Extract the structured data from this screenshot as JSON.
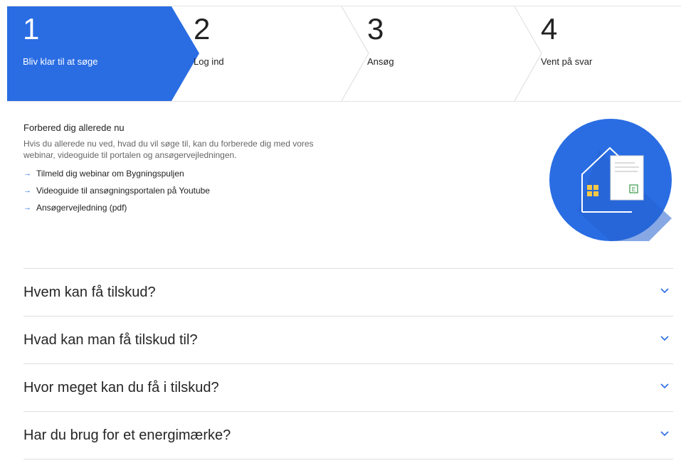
{
  "stepper": {
    "steps": [
      {
        "number": "1",
        "label": "Bliv klar til at søge",
        "active": true
      },
      {
        "number": "2",
        "label": "Log ind",
        "active": false
      },
      {
        "number": "3",
        "label": "Ansøg",
        "active": false
      },
      {
        "number": "4",
        "label": "Vent på svar",
        "active": false
      }
    ],
    "active_color": "#2a6de3"
  },
  "intro": {
    "heading": "Forbered dig allerede nu",
    "text": "Hvis du allerede nu ved, hvad du vil søge til, kan du forberede dig med vores webinar, videoguide til portalen og ansøgervejledningen.",
    "links": [
      {
        "label": "Tilmeld dig webinar om Bygningspuljen"
      },
      {
        "label": "Videoguide til ansøgningsportalen på Youtube"
      },
      {
        "label": "Ansøgervejledning (pdf)"
      }
    ]
  },
  "illustration": {
    "icon": "house-document-icon",
    "color": "#2a6de3"
  },
  "accordion": {
    "items": [
      {
        "question": "Hvem kan få tilskud?"
      },
      {
        "question": "Hvad kan man få tilskud til?"
      },
      {
        "question": "Hvor meget kan du få i tilskud?"
      },
      {
        "question": "Har du brug for et energimærke?"
      }
    ]
  }
}
